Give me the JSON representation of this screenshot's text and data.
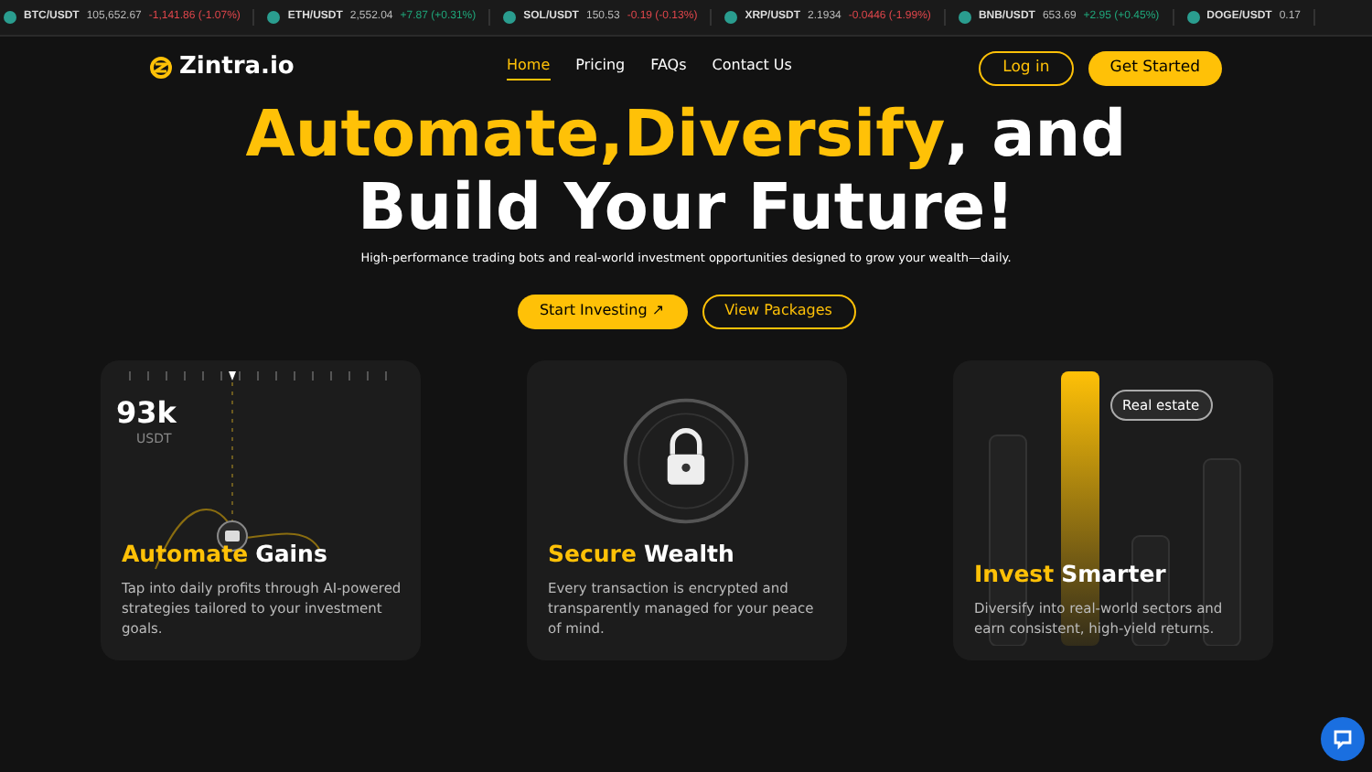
{
  "ticker": [
    {
      "pair": "BTC/USDT",
      "price": "105,652.67",
      "change": "-1,141.86 (-1.07%)",
      "kind": "down"
    },
    {
      "pair": "ETH/USDT",
      "price": "2,552.04",
      "change": "+7.87 (+0.31%)",
      "kind": "up"
    },
    {
      "pair": "SOL/USDT",
      "price": "150.53",
      "change": "-0.19 (-0.13%)",
      "kind": "down"
    },
    {
      "pair": "XRP/USDT",
      "price": "2.1934",
      "change": "-0.0446 (-1.99%)",
      "kind": "down"
    },
    {
      "pair": "BNB/USDT",
      "price": "653.69",
      "change": "+2.95 (+0.45%)",
      "kind": "up"
    },
    {
      "pair": "DOGE/USDT",
      "price": "0.17"
    }
  ],
  "brand": "Zintra.io",
  "nav": [
    {
      "label": "Home",
      "selected": true
    },
    {
      "label": "Pricing",
      "selected": false
    },
    {
      "label": "FAQs",
      "selected": false
    },
    {
      "label": "Contact Us",
      "selected": false
    }
  ],
  "login": "Log in",
  "get_started": "Get Started",
  "headline": [
    [
      {
        "text": "Automate,",
        "highlight": true
      },
      {
        "text": "Diversify",
        "highlight": true
      },
      {
        "text": ", and",
        "highlight": false
      }
    ],
    [
      {
        "text": "Build Your Future!",
        "highlight": false
      }
    ]
  ],
  "subtitle": "High-performance trading bots and real-world investment opportunities designed to grow your wealth—daily.",
  "cta_primary": "Start Investing ↗",
  "cta_secondary": "View Packages",
  "cards": [
    {
      "kind": "chart",
      "stat": "93k",
      "unit": "USDT",
      "title_highlight": "Automate",
      "title_rest": "Gains",
      "text": "Tap into daily profits through AI-powered strategies tailored to your investment goals."
    },
    {
      "kind": "lock",
      "title_highlight": "Secure",
      "title_rest": "Wealth",
      "text": "Every transaction is encrypted and transparently managed for your peace of mind."
    },
    {
      "kind": "bars",
      "tag": "Real estate",
      "title_highlight": "Invest",
      "title_rest": "Smarter",
      "text": "Diversify into real-world sectors and earn consistent, high-yield returns."
    }
  ]
}
